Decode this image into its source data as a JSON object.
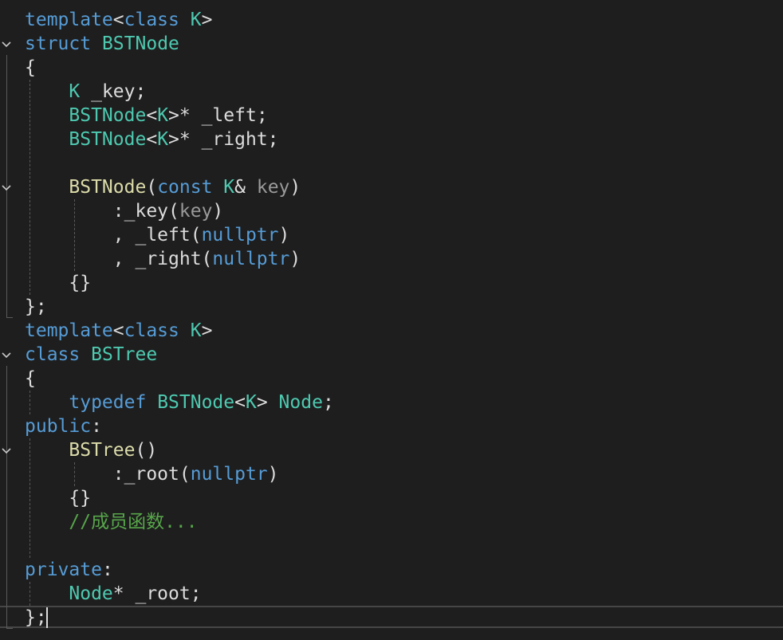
{
  "colors": {
    "background": "#1e1e1e",
    "keyword": "#569cd6",
    "type": "#4ec9b0",
    "function": "#dcdcaa",
    "parameter": "#9a9a9a",
    "comment": "#57a64a",
    "plain": "#dcdcdc"
  },
  "lines": [
    {
      "fold": false,
      "tokens": [
        {
          "t": "template",
          "c": "keyword"
        },
        {
          "t": "<",
          "c": "plain"
        },
        {
          "t": "class",
          "c": "keyword"
        },
        {
          "t": " ",
          "c": "plain"
        },
        {
          "t": "K",
          "c": "type"
        },
        {
          "t": ">",
          "c": "plain"
        }
      ]
    },
    {
      "fold": true,
      "tokens": [
        {
          "t": "struct",
          "c": "keyword"
        },
        {
          "t": " ",
          "c": "plain"
        },
        {
          "t": "BSTNode",
          "c": "type"
        }
      ]
    },
    {
      "fold": false,
      "tokens": [
        {
          "t": "{",
          "c": "plain"
        }
      ]
    },
    {
      "fold": false,
      "tokens": [
        {
          "t": "    ",
          "c": "plain"
        },
        {
          "t": "K",
          "c": "type"
        },
        {
          "t": " _key;",
          "c": "plain"
        }
      ]
    },
    {
      "fold": false,
      "tokens": [
        {
          "t": "    ",
          "c": "plain"
        },
        {
          "t": "BSTNode",
          "c": "type"
        },
        {
          "t": "<",
          "c": "plain"
        },
        {
          "t": "K",
          "c": "type"
        },
        {
          "t": ">* _left;",
          "c": "plain"
        }
      ]
    },
    {
      "fold": false,
      "tokens": [
        {
          "t": "    ",
          "c": "plain"
        },
        {
          "t": "BSTNode",
          "c": "type"
        },
        {
          "t": "<",
          "c": "plain"
        },
        {
          "t": "K",
          "c": "type"
        },
        {
          "t": ">* _right;",
          "c": "plain"
        }
      ]
    },
    {
      "fold": false,
      "tokens": []
    },
    {
      "fold": true,
      "tokens": [
        {
          "t": "    ",
          "c": "plain"
        },
        {
          "t": "BSTNode",
          "c": "function"
        },
        {
          "t": "(",
          "c": "plain"
        },
        {
          "t": "const",
          "c": "keyword"
        },
        {
          "t": " ",
          "c": "plain"
        },
        {
          "t": "K",
          "c": "type"
        },
        {
          "t": "& ",
          "c": "plain"
        },
        {
          "t": "key",
          "c": "parameter"
        },
        {
          "t": ")",
          "c": "plain"
        }
      ]
    },
    {
      "fold": false,
      "tokens": [
        {
          "t": "        :_key(",
          "c": "plain"
        },
        {
          "t": "key",
          "c": "parameter"
        },
        {
          "t": ")",
          "c": "plain"
        }
      ]
    },
    {
      "fold": false,
      "tokens": [
        {
          "t": "        , _left(",
          "c": "plain"
        },
        {
          "t": "nullptr",
          "c": "keyword"
        },
        {
          "t": ")",
          "c": "plain"
        }
      ]
    },
    {
      "fold": false,
      "tokens": [
        {
          "t": "        , _right(",
          "c": "plain"
        },
        {
          "t": "nullptr",
          "c": "keyword"
        },
        {
          "t": ")",
          "c": "plain"
        }
      ]
    },
    {
      "fold": false,
      "tokens": [
        {
          "t": "    {}",
          "c": "plain"
        }
      ]
    },
    {
      "fold": false,
      "tokens": [
        {
          "t": "};",
          "c": "plain"
        }
      ]
    },
    {
      "fold": false,
      "tokens": [
        {
          "t": "template",
          "c": "keyword"
        },
        {
          "t": "<",
          "c": "plain"
        },
        {
          "t": "class",
          "c": "keyword"
        },
        {
          "t": " ",
          "c": "plain"
        },
        {
          "t": "K",
          "c": "type"
        },
        {
          "t": ">",
          "c": "plain"
        }
      ]
    },
    {
      "fold": true,
      "tokens": [
        {
          "t": "class",
          "c": "keyword"
        },
        {
          "t": " ",
          "c": "plain"
        },
        {
          "t": "BSTree",
          "c": "type"
        }
      ]
    },
    {
      "fold": false,
      "tokens": [
        {
          "t": "{",
          "c": "plain"
        }
      ]
    },
    {
      "fold": false,
      "tokens": [
        {
          "t": "    ",
          "c": "plain"
        },
        {
          "t": "typedef",
          "c": "keyword"
        },
        {
          "t": " ",
          "c": "plain"
        },
        {
          "t": "BSTNode",
          "c": "type"
        },
        {
          "t": "<",
          "c": "plain"
        },
        {
          "t": "K",
          "c": "type"
        },
        {
          "t": "> ",
          "c": "plain"
        },
        {
          "t": "Node",
          "c": "type"
        },
        {
          "t": ";",
          "c": "plain"
        }
      ]
    },
    {
      "fold": false,
      "tokens": [
        {
          "t": "public",
          "c": "keyword"
        },
        {
          "t": ":",
          "c": "plain"
        }
      ]
    },
    {
      "fold": true,
      "tokens": [
        {
          "t": "    ",
          "c": "plain"
        },
        {
          "t": "BSTree",
          "c": "function"
        },
        {
          "t": "()",
          "c": "plain"
        }
      ]
    },
    {
      "fold": false,
      "tokens": [
        {
          "t": "        :_root(",
          "c": "plain"
        },
        {
          "t": "nullptr",
          "c": "keyword"
        },
        {
          "t": ")",
          "c": "plain"
        }
      ]
    },
    {
      "fold": false,
      "tokens": [
        {
          "t": "    {}",
          "c": "plain"
        }
      ]
    },
    {
      "fold": false,
      "tokens": [
        {
          "t": "    ",
          "c": "plain"
        },
        {
          "t": "//成员函数...",
          "c": "comment"
        }
      ]
    },
    {
      "fold": false,
      "tokens": []
    },
    {
      "fold": false,
      "tokens": [
        {
          "t": "private",
          "c": "keyword"
        },
        {
          "t": ":",
          "c": "plain"
        }
      ]
    },
    {
      "fold": false,
      "tokens": [
        {
          "t": "    ",
          "c": "plain"
        },
        {
          "t": "Node",
          "c": "type"
        },
        {
          "t": "* _root;",
          "c": "plain"
        }
      ]
    },
    {
      "fold": false,
      "tokens": [
        {
          "t": "};",
          "c": "plain"
        }
      ]
    }
  ]
}
